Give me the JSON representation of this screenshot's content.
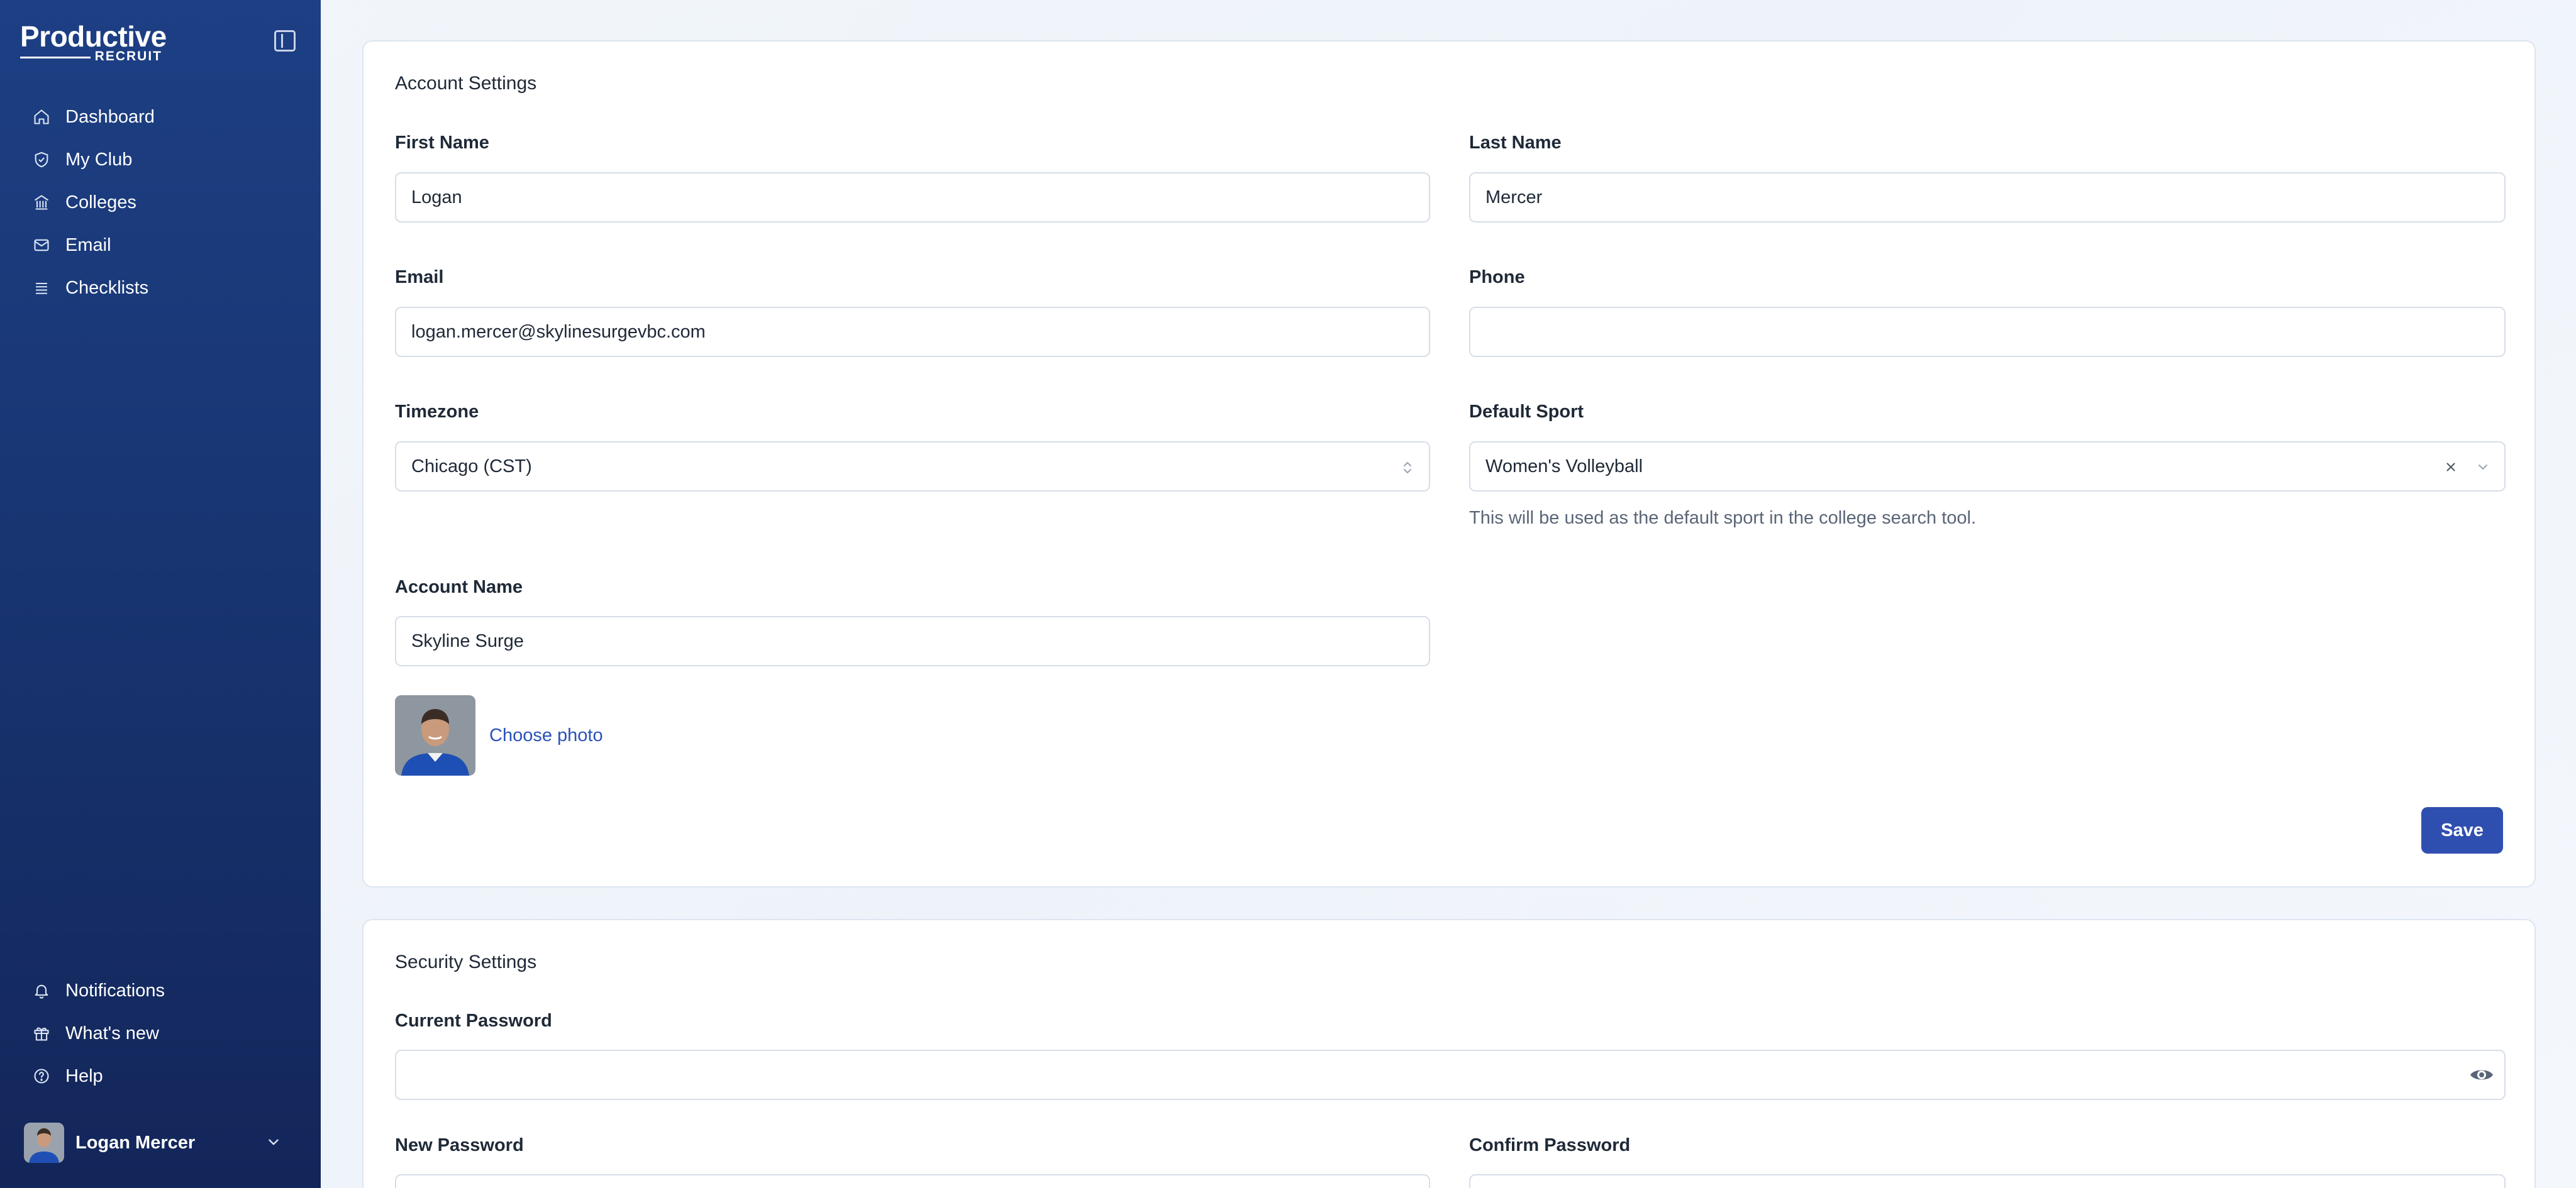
{
  "app": {
    "logo_main": "Productive",
    "logo_sub": "RECRUIT"
  },
  "sidebar": {
    "items": [
      {
        "label": "Dashboard",
        "icon": "home-icon"
      },
      {
        "label": "My Club",
        "icon": "shield-icon"
      },
      {
        "label": "Colleges",
        "icon": "building-icon"
      },
      {
        "label": "Email",
        "icon": "mail-icon"
      },
      {
        "label": "Checklists",
        "icon": "list-icon"
      }
    ],
    "bottom_items": [
      {
        "label": "Notifications",
        "icon": "bell-icon"
      },
      {
        "label": "What's new",
        "icon": "gift-icon"
      },
      {
        "label": "Help",
        "icon": "help-circle-icon"
      }
    ],
    "user": {
      "name": "Logan Mercer"
    }
  },
  "account": {
    "title": "Account Settings",
    "first_name_label": "First Name",
    "first_name_value": "Logan",
    "last_name_label": "Last Name",
    "last_name_value": "Mercer",
    "email_label": "Email",
    "email_value": "logan.mercer@skylinesurgevbc.com",
    "phone_label": "Phone",
    "phone_value": "",
    "timezone_label": "Timezone",
    "timezone_value": "Chicago (CST)",
    "sport_label": "Default Sport",
    "sport_value": "Women's Volleyball",
    "sport_hint": "This will be used as the default sport in the college search tool.",
    "account_name_label": "Account Name",
    "account_name_value": "Skyline Surge",
    "choose_photo": "Choose photo",
    "save": "Save"
  },
  "security": {
    "title": "Security Settings",
    "current_password_label": "Current Password",
    "new_password_label": "New Password",
    "confirm_password_label": "Confirm Password"
  },
  "colors": {
    "sidebar_top": "#1d3f84",
    "sidebar_bottom": "#13265a",
    "accent": "#2f4fb0",
    "link": "#2a52b8"
  }
}
